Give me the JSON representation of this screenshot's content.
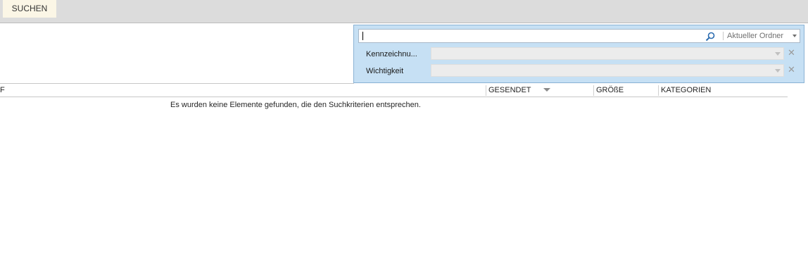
{
  "ribbon": {
    "tab_label": "SUCHEN"
  },
  "search": {
    "query": "",
    "scope_label": "Aktueller Ordner",
    "criteria": [
      {
        "label": "Kennzeichnu...",
        "value": ""
      },
      {
        "label": "Wichtigkeit",
        "value": ""
      }
    ]
  },
  "list": {
    "columns": {
      "first_partial": "F",
      "sent": "GESENDET",
      "size": "GRÖßE",
      "categories": "KATEGORIEN"
    },
    "sort_column": "sent",
    "sort_direction": "descending",
    "empty_message": "Es wurden keine Elemente gefunden, die den Suchkriterien entsprechen."
  },
  "colors": {
    "ribbon_bg": "#dcdcdc",
    "active_tab_bg": "#fbf6e6",
    "search_panel_bg": "#c6e0f4",
    "search_panel_border": "#8ab2d4",
    "search_icon": "#2b6cb0"
  }
}
